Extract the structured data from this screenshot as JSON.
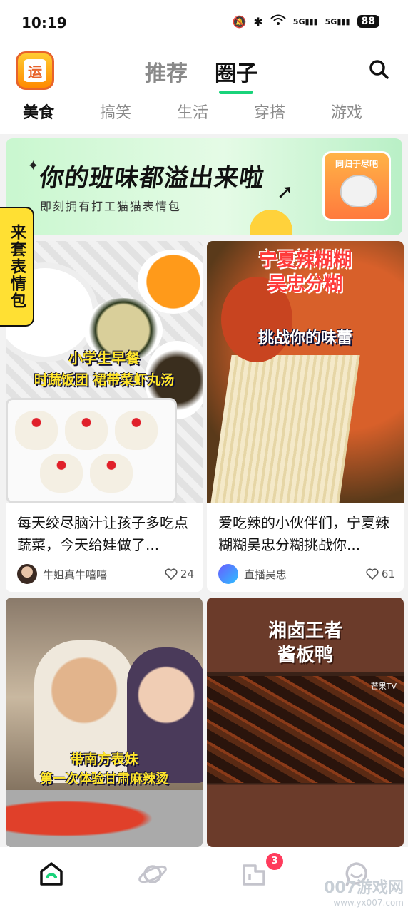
{
  "status_bar": {
    "time": "10:19",
    "network_1": "5G",
    "network_2": "5G",
    "battery": "88"
  },
  "header": {
    "logo_char": "运",
    "tabs": [
      {
        "label": "推荐",
        "active": false
      },
      {
        "label": "圈子",
        "active": true
      }
    ],
    "search_icon": "search-icon",
    "accent_color": "#19d37a"
  },
  "categories": [
    {
      "label": "美食",
      "active": true
    },
    {
      "label": "搞笑",
      "active": false
    },
    {
      "label": "生活",
      "active": false
    },
    {
      "label": "穿搭",
      "active": false
    },
    {
      "label": "游戏",
      "active": false
    }
  ],
  "banner": {
    "title": "你的班味都溢出来啦",
    "subtitle": "即刻拥有打工猫猫表情包",
    "card_label": "同归于尽吧"
  },
  "side_tag": "来套表情包",
  "feed": [
    {
      "caption_1": "小学生早餐",
      "caption_2": "时蔬饭团 裙带菜虾丸汤",
      "title": "每天绞尽脑汁让孩子多吃点蔬菜，今天给娃做了...",
      "author": "牛姐真牛嘻嘻",
      "likes": "24"
    },
    {
      "caption_1": "宁夏辣糊糊",
      "caption_2": "吴忠分糊",
      "caption_3": "挑战你的味蕾",
      "title": "爱吃辣的小伙伴们，宁夏辣糊糊吴忠分糊挑战你...",
      "author": "直播吴忠",
      "likes": "61"
    },
    {
      "caption_1": "带南方表妹",
      "caption_2": "第一次体验甘肃麻辣烫"
    },
    {
      "caption_1": "湘卤王者",
      "caption_2": "酱板鸭",
      "channel": "芒果TV"
    }
  ],
  "bottom_nav": {
    "items": [
      "home-icon",
      "planet-icon",
      "message-icon",
      "chat-icon"
    ],
    "badge": "3"
  },
  "watermark": {
    "line1": "007游戏网",
    "line2": "www.yx007.com"
  }
}
